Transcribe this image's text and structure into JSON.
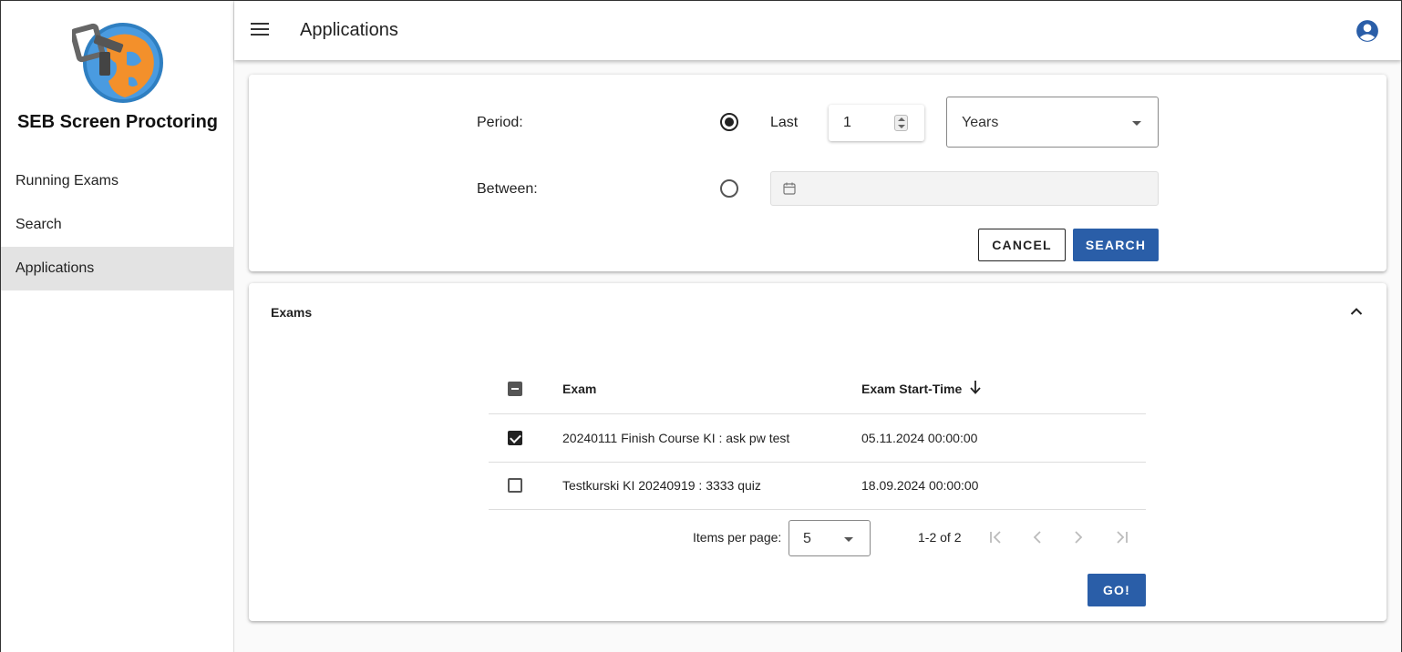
{
  "sidebar": {
    "app_title": "SEB Screen Proctoring",
    "items": [
      {
        "label": "Running Exams"
      },
      {
        "label": "Search"
      },
      {
        "label": "Applications"
      }
    ]
  },
  "header": {
    "title": "Applications"
  },
  "filter": {
    "period_label": "Period:",
    "between_label": "Between:",
    "last_label": "Last",
    "last_value": "1",
    "unit_selected": "Years",
    "period_checked": true,
    "between_checked": false,
    "cancel_label": "CANCEL",
    "search_label": "SEARCH"
  },
  "exams": {
    "title": "Exams",
    "columns": {
      "exam": "Exam",
      "start_time": "Exam Start-Time"
    },
    "rows": [
      {
        "exam": "20240111 Finish Course KI : ask pw test",
        "start_time": "05.11.2024 00:00:00",
        "checked": true
      },
      {
        "exam": "Testkurski KI 20240919 : 3333 quiz",
        "start_time": "18.09.2024 00:00:00",
        "checked": false
      }
    ],
    "pagination": {
      "items_per_page_label": "Items per page:",
      "items_per_page_value": "5",
      "range": "1-2 of 2"
    },
    "go_label": "GO!"
  },
  "colors": {
    "primary": "#2a5ea8",
    "account_icon": "#2a5ea8",
    "sidebar_active": "#e3e3e3"
  },
  "icons": [
    "menu-icon",
    "account-icon",
    "calendar-icon",
    "chevron-up-icon",
    "arrow-down-icon",
    "first-page-icon",
    "prev-page-icon",
    "next-page-icon",
    "last-page-icon"
  ]
}
